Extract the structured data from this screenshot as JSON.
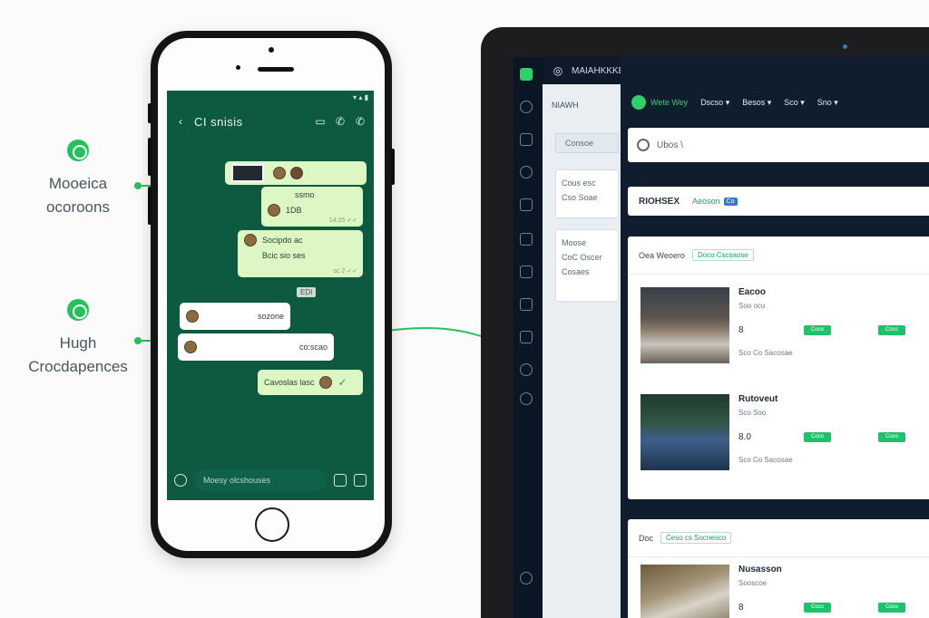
{
  "left_annotations": [
    {
      "line1": "Mooeica",
      "line2": "ocoroons"
    },
    {
      "line1": "Hugh",
      "line2": "Crocdapences"
    }
  ],
  "phone": {
    "chat_title": "CI snisis",
    "status_icons": "▾ ▴ ▮",
    "bubbles": [
      {
        "text": "",
        "side": "out",
        "time": ""
      },
      {
        "text": "",
        "side": "out",
        "time": "14:25 ✓✓"
      },
      {
        "text": "Socipdo ac",
        "side": "out",
        "time": "sc 2 ✓✓"
      },
      {
        "text": "",
        "side": "in",
        "time": ""
      },
      {
        "text": "",
        "side": "in",
        "time": ""
      },
      {
        "text": "Cavoslas lasc",
        "side": "out",
        "time": ""
      }
    ],
    "bubble_lines": {
      "b1_top": "ssmo",
      "b2_line": "1DB",
      "b3_line2": "Bcic sio ses",
      "b4_line": "sozone",
      "b5_line": "co:scao"
    },
    "date_chip": "EDI",
    "input_placeholder": "Moesy olcshouses"
  },
  "laptop": {
    "topbar_title": "MAIAHKKKE",
    "sidebar_top": "NIAWH",
    "sidebar_button": "Consoe",
    "sidebar_card_1": [
      "Cous esc",
      "Cso Soae"
    ],
    "sidebar_card_2": [
      "Moose",
      "CoC Oscer",
      "Cosaes"
    ],
    "brand": "Wete Wey",
    "nav": [
      "Dscso ▾",
      "Besos ▾",
      "Sco ▾",
      "Sno ▾"
    ],
    "search_text": "Ubos \\",
    "header_title": "RIOHSEX",
    "header_green": "Aeoson",
    "header_tag": "Co",
    "list_head_label": "Oea Weoero",
    "list_head_chip": "Doco Cscsaose",
    "rows": [
      {
        "title": "Eacoo",
        "sub": "Soo oco",
        "num": "8",
        "foot": "Sco   Co   Sacosae",
        "pills": [
          "Coco",
          "Coco"
        ]
      },
      {
        "title": "Rutoveut",
        "sub": "Sco Soo",
        "num": "8.0",
        "foot": "Sco   Co   Sacosae",
        "pills": [
          "Coco",
          "Coco"
        ]
      },
      {
        "title": "Nusasson",
        "sub": "Sooscoe",
        "num": "8",
        "foot": "",
        "pills": [
          "Coco",
          "Coco"
        ]
      }
    ],
    "bottom_head_label": "Doc",
    "bottom_head_chip": "Ceso cs Socnesco"
  }
}
